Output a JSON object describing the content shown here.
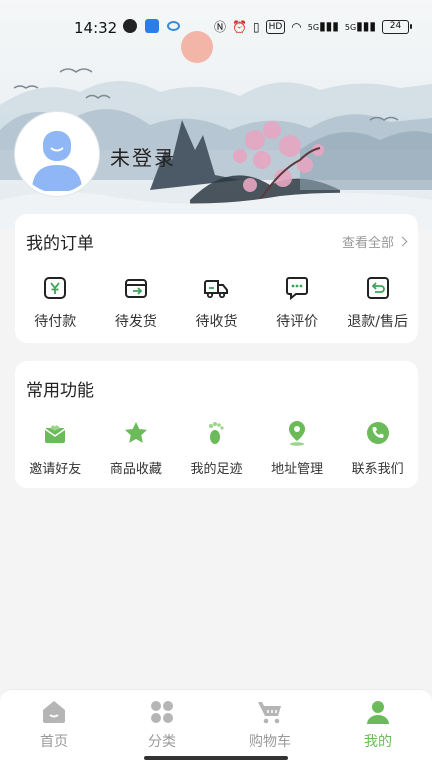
{
  "status_bar": {
    "time": "14:32",
    "battery": "24",
    "hd_label": "HD",
    "net_labels": [
      "5G",
      "5G"
    ]
  },
  "profile": {
    "name": "未登录"
  },
  "orders": {
    "title": "我的订单",
    "view_all": "查看全部",
    "items": [
      {
        "label": "待付款",
        "icon": "yuan-wallet-icon"
      },
      {
        "label": "待发货",
        "icon": "box-send-icon"
      },
      {
        "label": "待收货",
        "icon": "truck-icon"
      },
      {
        "label": "待评价",
        "icon": "comment-bubble-icon"
      },
      {
        "label": "退款/售后",
        "icon": "return-arrow-icon"
      }
    ]
  },
  "functions": {
    "title": "常用功能",
    "items": [
      {
        "label": "邀请好友",
        "icon": "invite-envelope-icon"
      },
      {
        "label": "商品收藏",
        "icon": "star-icon"
      },
      {
        "label": "我的足迹",
        "icon": "footprint-icon"
      },
      {
        "label": "地址管理",
        "icon": "location-pin-icon"
      },
      {
        "label": "联系我们",
        "icon": "phone-icon"
      }
    ]
  },
  "tabbar": {
    "items": [
      {
        "label": "首页",
        "icon": "home-icon",
        "active": false
      },
      {
        "label": "分类",
        "icon": "category-grid-icon",
        "active": false
      },
      {
        "label": "购物车",
        "icon": "cart-icon",
        "active": false
      },
      {
        "label": "我的",
        "icon": "user-icon",
        "active": true
      }
    ]
  },
  "colors": {
    "accent": "#6cbb5a",
    "avatar": "#8fb6f5",
    "inactive": "#b5b5b5",
    "icon_dark": "#222222"
  }
}
